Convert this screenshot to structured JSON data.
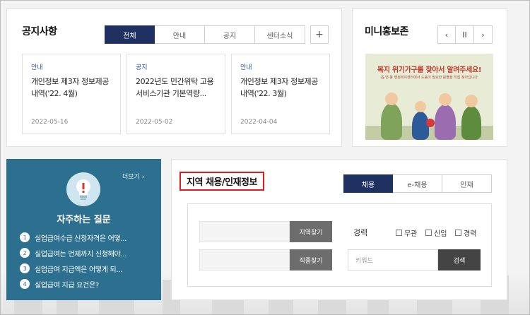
{
  "notice": {
    "title": "공지사항",
    "tabs": [
      {
        "label": "전체",
        "active": true
      },
      {
        "label": "안내",
        "active": false
      },
      {
        "label": "공지",
        "active": false
      },
      {
        "label": "센터소식",
        "active": false
      }
    ],
    "add_label": "+",
    "posts": [
      {
        "category": "안내",
        "title": "개인정보 제3자 정보제공 내역('22. 4월)",
        "date": "2022-05-16"
      },
      {
        "category": "공지",
        "title": "2022년도 민간위탁 고용서비스기관 기본역량...",
        "date": "2022-05-02"
      },
      {
        "category": "안내",
        "title": "개인정보 제3자 정보제공 내역('22. 3월)",
        "date": "2022-04-04"
      }
    ]
  },
  "mini": {
    "title": "미니홍보존",
    "prev": "‹",
    "pause": "II",
    "next": "›",
    "banner_headline": "복지 위기가구를 찾아서 알려주세요!",
    "banner_sub": "읍·면·동 행정복지센터에서 도움이 필요한 분들을 직접 찾아갑니다"
  },
  "faq": {
    "more": "더보기 ›",
    "title": "자주하는 질문",
    "items": [
      {
        "num": "1",
        "text": "실업급여수급 신청자격은 어떻..."
      },
      {
        "num": "2",
        "text": "실업급여는 언제까지 신청해야..."
      },
      {
        "num": "3",
        "text": "실업급여 지급액은 어떻게 되..."
      },
      {
        "num": "4",
        "text": "실업급여 지급 요건은?"
      }
    ]
  },
  "jobs": {
    "title": "지역 채용/인재정보",
    "tabs": [
      {
        "label": "채용",
        "active": true
      },
      {
        "label": "e-채용",
        "active": false
      },
      {
        "label": "인재",
        "active": false
      }
    ],
    "region_btn": "지역찾기",
    "job_btn": "직종찾기",
    "career_label": "경력",
    "checks": [
      "무관",
      "신입",
      "경력"
    ],
    "keyword_placeholder": "키워드",
    "search_btn": "검색"
  }
}
